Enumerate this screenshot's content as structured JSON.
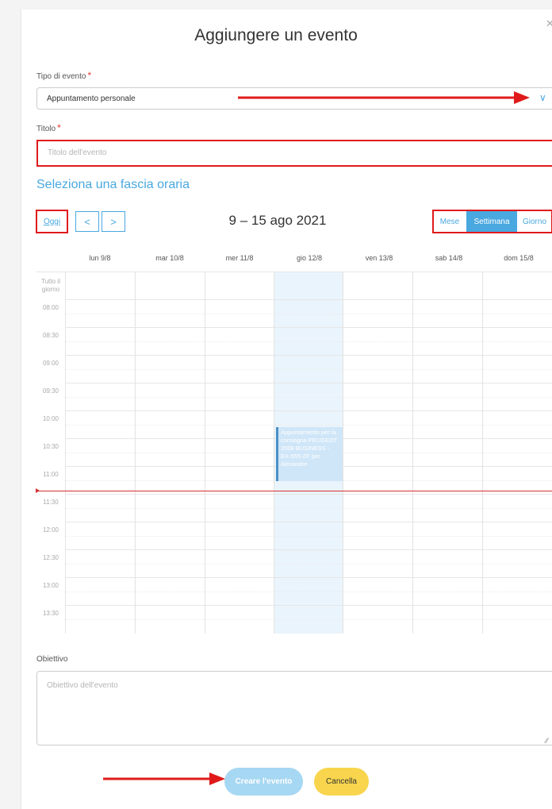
{
  "modal": {
    "title": "Aggiungere un evento",
    "close_icon": "close-icon"
  },
  "form": {
    "event_type_label": "Tipo di evento",
    "required_mark": "*",
    "event_type_value": "Appuntamento personale",
    "title_label": "Titolo",
    "title_placeholder": "Titolo dell'evento",
    "section_heading": "Seleziona una fascia oraria",
    "goal_label": "Obiettivo",
    "goal_placeholder": "Obiettivo dell'evento"
  },
  "calendar": {
    "today_label": "Oggi",
    "prev_icon": "<",
    "next_icon": ">",
    "range": "9 – 15 ago 2021",
    "views": [
      "Mese",
      "Settimana",
      "Giorno"
    ],
    "active_view": "Settimana",
    "days": [
      "lun 9/8",
      "mar 10/8",
      "mer 11/8",
      "gio 12/8",
      "ven 13/8",
      "sab 14/8",
      "dom 15/8"
    ],
    "today_day": "gio 12/8",
    "all_day_label": "Tutto il giorno",
    "times": [
      "08:00",
      "08:30",
      "09:00",
      "09:30",
      "10:00",
      "10:30",
      "11:00",
      "11:30",
      "12:00",
      "12:30",
      "13:00",
      "13:30"
    ],
    "event_text": "Appuntamento per la consegna PEUGEOT 2008 BUSINESS - EX-555-ZF per Alexandre"
  },
  "actions": {
    "create_label": "Creare l'evento",
    "cancel_label": "Cancella"
  },
  "colors": {
    "accent": "#4aa8e0",
    "annotation": "#e01a1a",
    "cancel": "#f8d54d"
  }
}
